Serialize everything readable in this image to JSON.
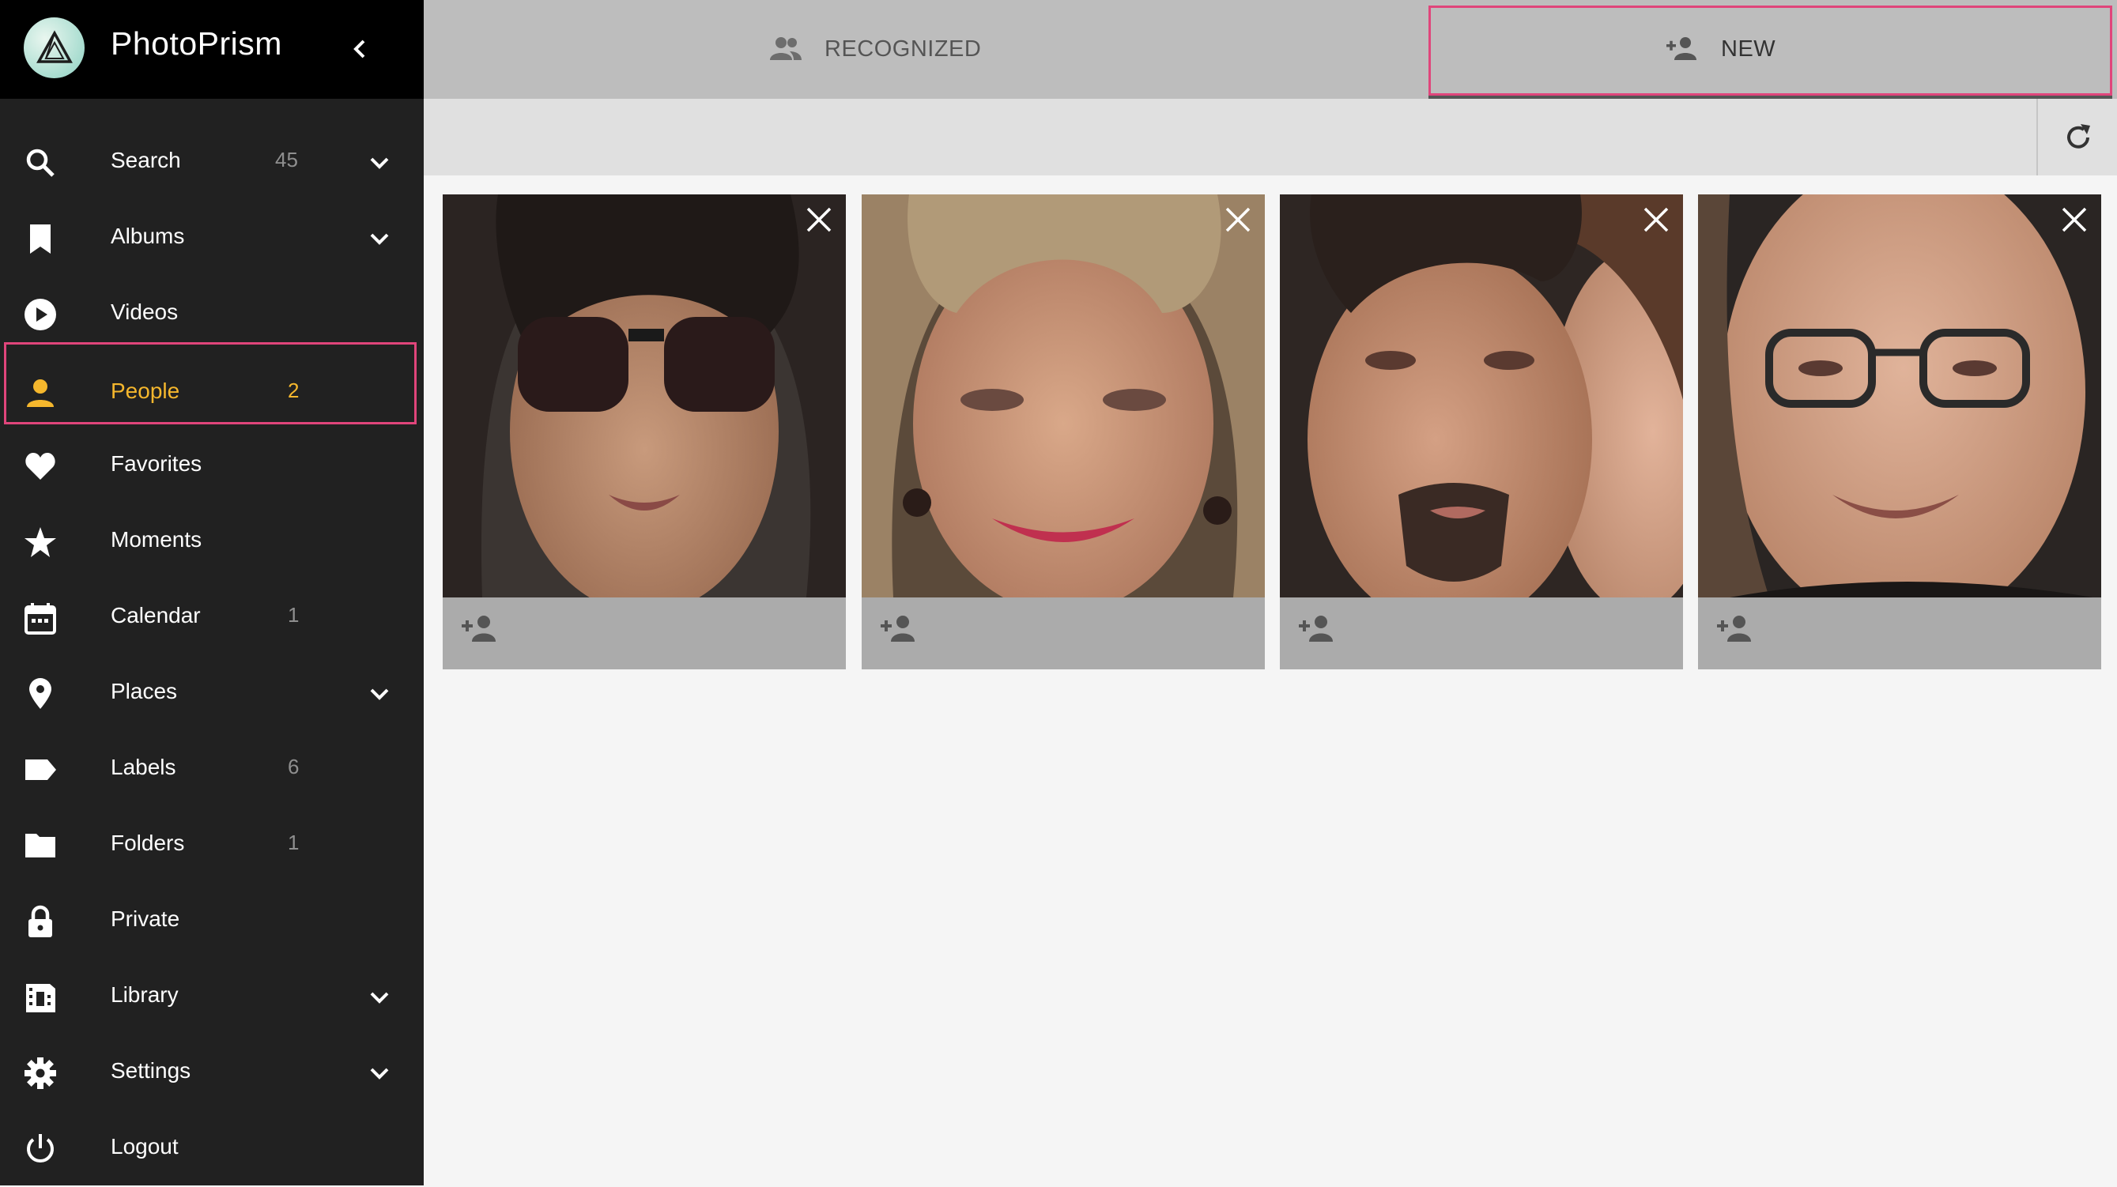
{
  "app": {
    "title": "PhotoPrism"
  },
  "sidebar": {
    "items": [
      {
        "id": "search",
        "label": "Search",
        "count": "45",
        "icon": "search-icon",
        "expandable": true
      },
      {
        "id": "albums",
        "label": "Albums",
        "count": "",
        "icon": "bookmark-icon",
        "expandable": true
      },
      {
        "id": "videos",
        "label": "Videos",
        "count": "",
        "icon": "play-circle-icon",
        "expandable": false
      },
      {
        "id": "people",
        "label": "People",
        "count": "2",
        "icon": "person-icon",
        "expandable": false,
        "active": true
      },
      {
        "id": "favorites",
        "label": "Favorites",
        "count": "",
        "icon": "heart-icon",
        "expandable": false
      },
      {
        "id": "moments",
        "label": "Moments",
        "count": "",
        "icon": "star-icon",
        "expandable": false
      },
      {
        "id": "calendar",
        "label": "Calendar",
        "count": "1",
        "icon": "calendar-icon",
        "expandable": false
      },
      {
        "id": "places",
        "label": "Places",
        "count": "",
        "icon": "place-pin-icon",
        "expandable": true
      },
      {
        "id": "labels",
        "label": "Labels",
        "count": "6",
        "icon": "label-tag-icon",
        "expandable": false
      },
      {
        "id": "folders",
        "label": "Folders",
        "count": "1",
        "icon": "folder-icon",
        "expandable": false
      },
      {
        "id": "private",
        "label": "Private",
        "count": "",
        "icon": "lock-icon",
        "expandable": false
      },
      {
        "id": "library",
        "label": "Library",
        "count": "",
        "icon": "film-icon",
        "expandable": true
      },
      {
        "id": "settings",
        "label": "Settings",
        "count": "",
        "icon": "gear-icon",
        "expandable": true
      },
      {
        "id": "logout",
        "label": "Logout",
        "count": "",
        "icon": "power-icon",
        "expandable": false
      }
    ]
  },
  "tabs": [
    {
      "label": "RECOGNIZED",
      "icon": "people-icon",
      "active": false
    },
    {
      "label": "NEW",
      "icon": "person-add-icon",
      "active": true
    }
  ],
  "toolbar": {
    "refresh_icon": "refresh-icon"
  },
  "faces": [
    {
      "id": "face-1",
      "description": "young man with long dark hair and sunglasses"
    },
    {
      "id": "face-2",
      "description": "older woman with blond hair and pink lipstick"
    },
    {
      "id": "face-3",
      "description": "man with goatee beside woman"
    },
    {
      "id": "face-4",
      "description": "bald man with glasses smiling"
    }
  ],
  "colors": {
    "sidebar_bg": "#212121",
    "brand_bg": "#000000",
    "active_accent": "#f5b72d",
    "highlight_border": "#e0457b",
    "tabs_bg": "#bdbdbd",
    "toolbar_bg": "#e0e0e0",
    "page_bg": "#f5f5f5"
  }
}
